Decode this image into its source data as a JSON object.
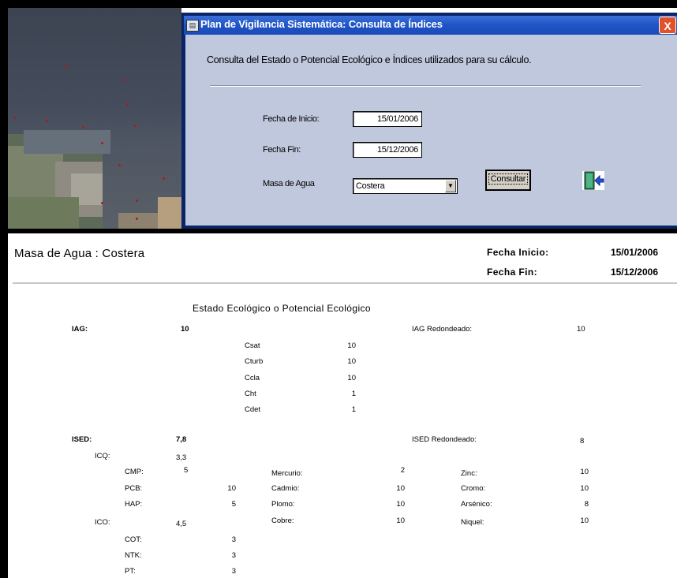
{
  "dialog": {
    "title": "Plan de Vigilancia Sistemática: Consulta de Índices",
    "close_label": "X",
    "heading": "Consulta del Estado o  Potencial Ecológico e  Índices utilizados para su cálculo.",
    "fecha_inicio_label": "Fecha de Inicio:",
    "fecha_inicio_value": "15/01/2006",
    "fecha_fin_label": "Fecha Fin:",
    "fecha_fin_value": "15/12/2006",
    "masa_agua_label": "Masa de Agua",
    "masa_agua_value": "Costera",
    "consultar_label": "Consultar"
  },
  "report": {
    "title": "Masa de Agua : Costera",
    "fecha_inicio_label": "Fecha Inicio:",
    "fecha_inicio_value": "15/01/2006",
    "fecha_fin_label": "Fecha Fin:",
    "fecha_fin_value": "15/12/2006",
    "section_title": "Estado Ecológico o Potencial Ecológico",
    "iag": {
      "label": "IAG:",
      "value": "10",
      "rounded_label": "IAG Redondeado:",
      "rounded_value": "10",
      "subs": [
        {
          "label": "Csat",
          "value": "10"
        },
        {
          "label": "Cturb",
          "value": "10"
        },
        {
          "label": "Ccla",
          "value": "10"
        },
        {
          "label": "Cht",
          "value": "1"
        },
        {
          "label": "Cdet",
          "value": "1"
        }
      ]
    },
    "ised": {
      "label": "ISED:",
      "value": "7,8",
      "rounded_label": "ISED Redondeado:",
      "rounded_value": "8",
      "icq": {
        "label": "ICQ:",
        "value": "3,3"
      },
      "ico": {
        "label": "ICO:",
        "value": "4,5"
      },
      "cmp": {
        "label": "CMP:",
        "value": "5"
      },
      "pcb": {
        "label": "PCB:",
        "value": "10"
      },
      "hap": {
        "label": "HAP:",
        "value": "5"
      },
      "cot": {
        "label": "COT:",
        "value": "3"
      },
      "ntk": {
        "label": "NTK:",
        "value": "3"
      },
      "pt": {
        "label": "PT:",
        "value": "3"
      },
      "mercurio": {
        "label": "Mercurio:",
        "value": "2"
      },
      "cadmio": {
        "label": "Cadmio:",
        "value": "10"
      },
      "plomo": {
        "label": "Plomo:",
        "value": "10"
      },
      "cobre": {
        "label": "Cobre:",
        "value": "10"
      },
      "zinc": {
        "label": "Zinc:",
        "value": "10"
      },
      "cromo": {
        "label": "Cromo:",
        "value": "10"
      },
      "arsenico": {
        "label": "Arsénico:",
        "value": "8"
      },
      "niquel": {
        "label": "Niquel:",
        "value": "10"
      }
    }
  }
}
